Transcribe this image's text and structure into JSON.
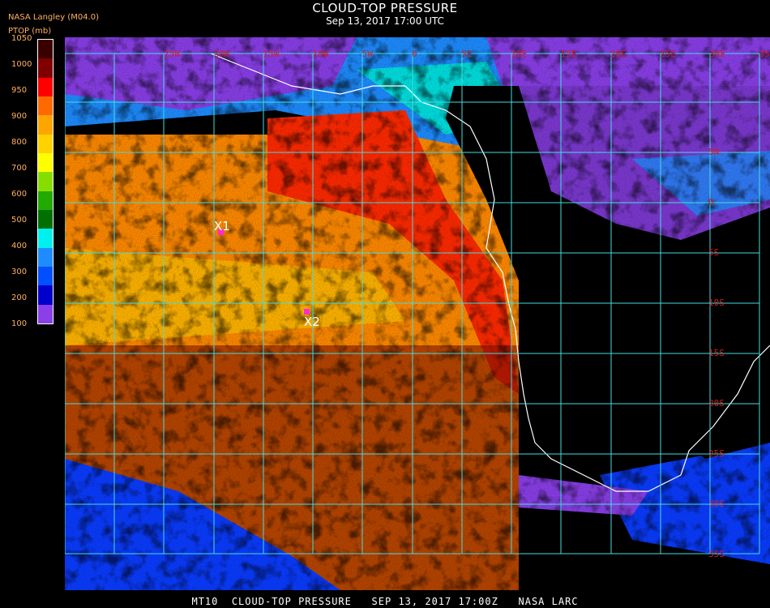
{
  "header": {
    "source": "NASA Langley (M04.0)",
    "title": "CLOUD-TOP PRESSURE",
    "datetime": "Sep 13, 2017 17:00 UTC"
  },
  "legend": {
    "title": "PTOP (mb)",
    "ticks": [
      "1050",
      "1000",
      "950",
      "900",
      "800",
      "700",
      "600",
      "500",
      "400",
      "300",
      "200",
      "100"
    ],
    "colors": [
      "#3a0000",
      "#800000",
      "#ff0000",
      "#ff6a00",
      "#ffa500",
      "#ffd200",
      "#ffff00",
      "#88dd00",
      "#22aa00",
      "#007000",
      "#00f0f0",
      "#1e8cff",
      "#0050ff",
      "#0000cc",
      "#8a3fe8"
    ]
  },
  "map": {
    "lon_labels": [
      "25W",
      "20W",
      "15W",
      "10W",
      "5W",
      "0",
      "5E",
      "10E",
      "15E",
      "20E",
      "25E",
      "30E",
      "35E"
    ],
    "lat_labels": [
      "5N",
      "0",
      "5S",
      "10S",
      "15S",
      "20S",
      "25S",
      "30S",
      "35S"
    ],
    "markers": [
      {
        "label": "X1",
        "color": "#ff2ad4"
      },
      {
        "label": "X2",
        "color": "#ff2ad4"
      }
    ],
    "grid_color": "#44dddd",
    "coast_color": "#ffffff"
  },
  "footer": {
    "text": "MT10  CLOUD-TOP PRESSURE   SEP 13, 2017 17:00Z   NASA LARC"
  }
}
